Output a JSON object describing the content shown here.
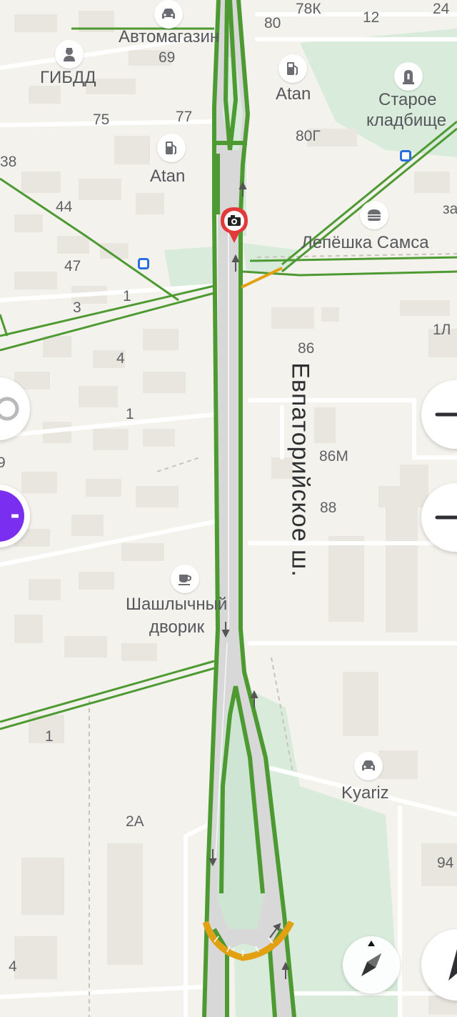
{
  "street": {
    "name": "Евпаторийское ш."
  },
  "pois": [
    {
      "name": "Автомагазин",
      "icon": "car-icon"
    },
    {
      "name": "ГИБДД",
      "icon": "police-icon"
    },
    {
      "name": "Atan",
      "icon": "fuel-icon"
    },
    {
      "name": "Atan",
      "icon": "fuel-icon"
    },
    {
      "name": "Старое кладбище",
      "line1": "Старое",
      "line2": "кладбище",
      "icon": "cemetery-icon"
    },
    {
      "name": "Лепёшка Самса",
      "icon": "burger-icon"
    },
    {
      "name": "Шашлычный дворик",
      "line1": "Шашлычный",
      "line2": "дворик",
      "icon": "cafe-icon"
    },
    {
      "name": "Kyariz",
      "icon": "car-icon"
    }
  ],
  "house_numbers": [
    "78К",
    "12",
    "24",
    "80",
    "69",
    "75",
    "77",
    "80Г",
    "38",
    "44",
    "за",
    "47",
    "1",
    "3",
    "1Л",
    "4",
    "86",
    "1",
    "9",
    "86М",
    "88",
    "1",
    "2А",
    "94",
    "4"
  ],
  "colors": {
    "background": "#f4f2ec",
    "traffic_green": "#4e9a32",
    "traffic_yellow": "#e2a112",
    "park": "#d9ecdc",
    "road": "#d8d8d8",
    "camera_red": "#e23a3a",
    "accent_purple": "#7a2ff0"
  },
  "controls": {
    "zoom_in": "+",
    "zoom_out": "−",
    "compass": "compass-icon"
  }
}
